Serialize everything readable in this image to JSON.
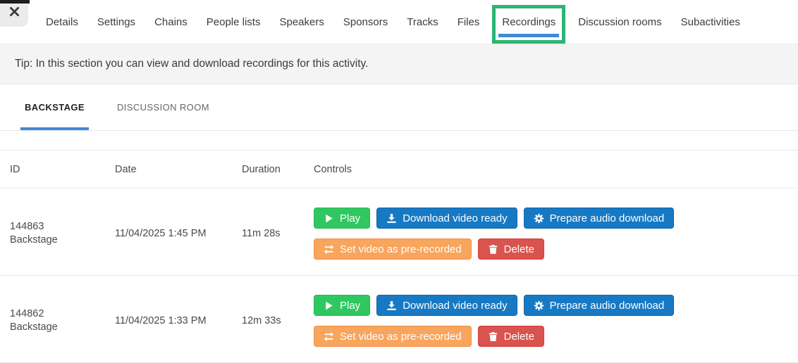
{
  "header": {
    "tabs": [
      "Details",
      "Settings",
      "Chains",
      "People lists",
      "Speakers",
      "Sponsors",
      "Tracks",
      "Files",
      "Recordings",
      "Discussion rooms",
      "Subactivities"
    ],
    "active_tab": "Recordings"
  },
  "tip": "Tip: In this section you can view and download recordings for this activity.",
  "subtabs": {
    "items": [
      "BACKSTAGE",
      "DISCUSSION ROOM"
    ],
    "active": "BACKSTAGE"
  },
  "table": {
    "columns": [
      "ID",
      "Date",
      "Duration",
      "Controls"
    ],
    "rows": [
      {
        "id": "144863",
        "room": "Backstage",
        "date": "11/04/2025 1:45 PM",
        "duration": "11m 28s"
      },
      {
        "id": "144862",
        "room": "Backstage",
        "date": "11/04/2025 1:33 PM",
        "duration": "12m 33s"
      }
    ],
    "controls": {
      "play": "Play",
      "download_video": "Download video ready",
      "prepare_audio": "Prepare audio download",
      "set_prerecorded": "Set video as pre-recorded",
      "delete": "Delete"
    }
  },
  "colors": {
    "highlight_box": "#2cb573",
    "active_underline": "#4189d6",
    "green_button": "#2fc860",
    "blue_button": "#1779c4",
    "orange_button": "#f8a55e",
    "red_button": "#d9534f"
  }
}
